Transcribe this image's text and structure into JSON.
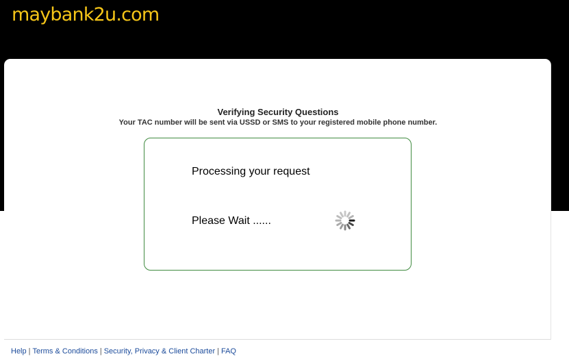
{
  "brand": {
    "logo_text": "maybank2u.com",
    "logo_color": "#f5c518"
  },
  "verification": {
    "title": "Verifying Security Questions",
    "subtitle": "Your TAC number will be sent via USSD or SMS to your registered mobile phone number."
  },
  "status": {
    "processing_text": "Processing your request",
    "wait_text": "Please Wait ......",
    "spinner_icon": "loading-spinner-icon",
    "border_color": "#3f8a3f"
  },
  "footer": {
    "links": [
      "Help",
      "Terms & Conditions",
      "Security, Privacy & Client Charter",
      "FAQ"
    ],
    "separator": "|",
    "link_color": "#1a4a9a"
  }
}
